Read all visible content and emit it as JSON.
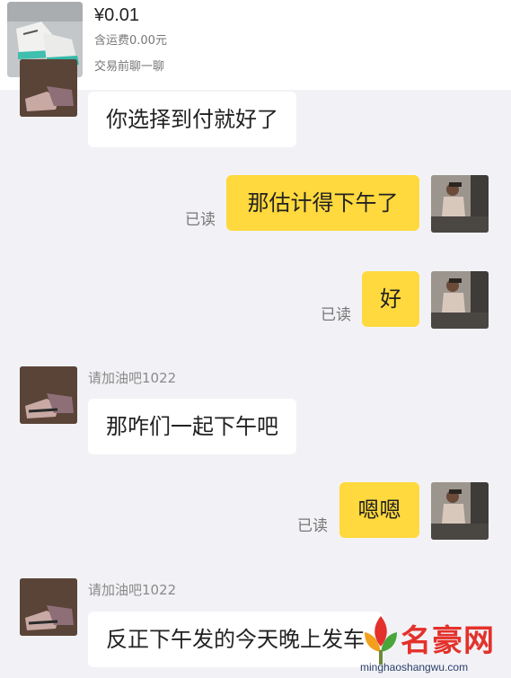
{
  "product": {
    "price": "¥0.01",
    "shipping": "含运费0.00元",
    "pre_chat": "交易前聊一聊"
  },
  "messages": [
    {
      "direction": "in",
      "text": "你选择到付就好了",
      "avatar": "shoe-photo"
    },
    {
      "direction": "out",
      "text": "那估计得下午了",
      "status": "已读",
      "avatar": "gym-photo"
    },
    {
      "direction": "out",
      "text": "好",
      "status": "已读",
      "avatar": "gym-photo"
    },
    {
      "direction": "in",
      "sender": "请加油吧1022",
      "text": "那咋们一起下午吧",
      "avatar": "shoe-photo"
    },
    {
      "direction": "out",
      "text": "嗯嗯",
      "status": "已读",
      "avatar": "gym-photo"
    },
    {
      "direction": "in",
      "sender": "请加油吧1022",
      "text": "反正下午发的今天晚上发车",
      "avatar": "shoe-photo"
    }
  ],
  "watermark": {
    "name": "名豪网",
    "url": "minghaoshangwu.com"
  },
  "colors": {
    "background": "#f2f2f6",
    "outgoing_bubble": "#ffd93d",
    "incoming_bubble": "#ffffff",
    "watermark_red": "#e4312b"
  }
}
